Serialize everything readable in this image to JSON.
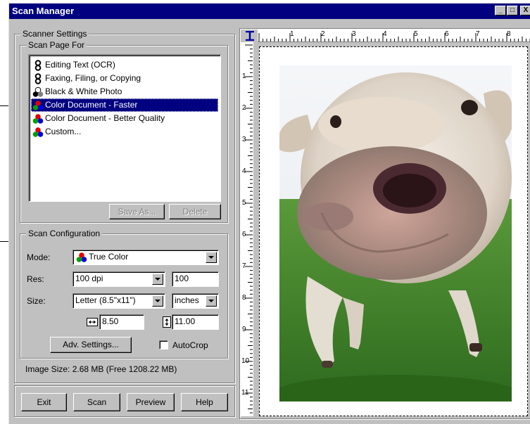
{
  "window": {
    "title": "Scan Manager",
    "buttons": {
      "minimize": "_",
      "maximize": "□",
      "close": "X"
    }
  },
  "scanner_settings": {
    "legend": "Scanner Settings",
    "scan_page_for": {
      "legend": "Scan Page For",
      "items": [
        {
          "label": "Editing Text (OCR)",
          "icon": "ocr-text-icon",
          "selected": false
        },
        {
          "label": "Faxing, Filing, or Copying",
          "icon": "fax-copy-icon",
          "selected": false
        },
        {
          "label": "Black & White Photo",
          "icon": "bw-photo-icon",
          "selected": false
        },
        {
          "label": "Color Document - Faster",
          "icon": "color-doc-fast-icon",
          "selected": true
        },
        {
          "label": "Color Document - Better Quality",
          "icon": "color-doc-quality-icon",
          "selected": false
        },
        {
          "label": "Custom...",
          "icon": "custom-icon",
          "selected": false
        }
      ],
      "save_as_label": "Save As...",
      "delete_label": "Delete"
    },
    "scan_configuration": {
      "legend": "Scan Configuration",
      "mode_label": "Mode:",
      "mode_value": "True Color",
      "res_label": "Res:",
      "res_value": "100 dpi",
      "res_custom": "100",
      "size_label": "Size:",
      "size_value": "Letter (8.5\"x11\")",
      "unit_value": "inches",
      "width_value": "8.50",
      "height_value": "11.00",
      "adv_settings_label": "Adv. Settings...",
      "autocrop_label": "AutoCrop",
      "autocrop_checked": false
    },
    "image_size": "Image Size: 2.68 MB (Free 1208.22 MB)"
  },
  "actions": {
    "exit": "Exit",
    "scan": "Scan",
    "preview": "Preview",
    "help": "Help"
  },
  "ruler": {
    "horizontal": [
      "1",
      "2",
      "3",
      "4",
      "5",
      "6",
      "7",
      "8"
    ],
    "vertical": [
      "1",
      "2",
      "3",
      "4",
      "5",
      "6",
      "7",
      "8",
      "9",
      "10",
      "11"
    ],
    "corner_icon": "ibeam-unit-icon"
  },
  "colors": {
    "title_bar": "#000080",
    "face": "#c0c0c0",
    "selection": "#000080"
  }
}
